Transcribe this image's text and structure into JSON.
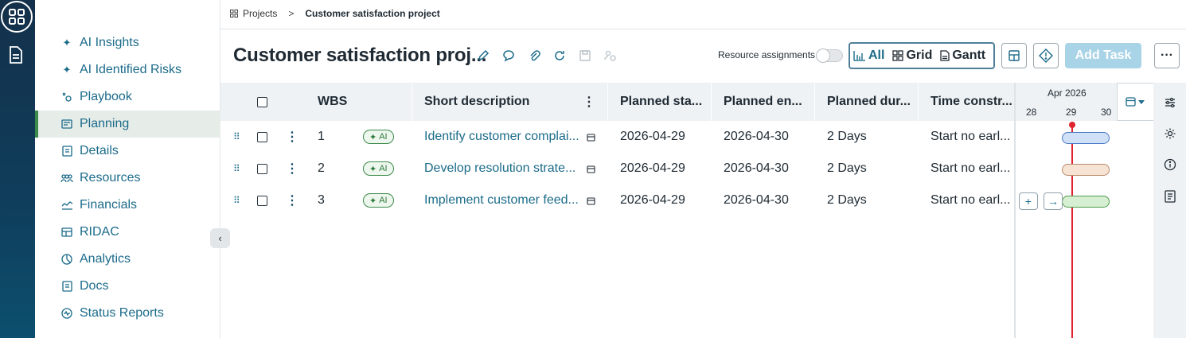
{
  "breadcrumb": {
    "root": "Projects",
    "separator": ">",
    "current": "Customer satisfaction project"
  },
  "sidebar": {
    "items": [
      {
        "label": "AI Insights",
        "icon": "sparkle-icon"
      },
      {
        "label": "AI Identified Risks",
        "icon": "sparkle-icon"
      },
      {
        "label": "Playbook",
        "icon": "playbook-icon"
      },
      {
        "label": "Planning",
        "icon": "planning-icon",
        "active": true
      },
      {
        "label": "Details",
        "icon": "details-icon"
      },
      {
        "label": "Resources",
        "icon": "resources-icon"
      },
      {
        "label": "Financials",
        "icon": "financials-icon"
      },
      {
        "label": "RIDAC",
        "icon": "ridac-icon"
      },
      {
        "label": "Analytics",
        "icon": "analytics-icon"
      },
      {
        "label": "Docs",
        "icon": "docs-icon"
      },
      {
        "label": "Status Reports",
        "icon": "status-reports-icon"
      }
    ]
  },
  "header": {
    "title": "Customer satisfaction proj...",
    "resource_assignments_label": "Resource assignments",
    "resource_assignments_on": false,
    "views": {
      "all": "All",
      "grid": "Grid",
      "gantt": "Gantt"
    },
    "active_view": "all",
    "add_task_label": "Add Task",
    "more_label": "···"
  },
  "table": {
    "columns": {
      "wbs": "WBS",
      "short_description": "Short description",
      "planned_start": "Planned sta...",
      "planned_end": "Planned en...",
      "planned_duration": "Planned dur...",
      "time_constraint": "Time constr..."
    },
    "rows": [
      {
        "wbs": "1",
        "badge": "AI",
        "desc": "Identify customer complai...",
        "start": "2026-04-29",
        "end": "2026-04-30",
        "duration": "2 Days",
        "constraint": "Start no earl..."
      },
      {
        "wbs": "2",
        "badge": "AI",
        "desc": "Develop resolution strate...",
        "start": "2026-04-29",
        "end": "2026-04-30",
        "duration": "2 Days",
        "constraint": "Start no earl..."
      },
      {
        "wbs": "3",
        "badge": "AI",
        "desc": "Implement customer feed...",
        "start": "2026-04-29",
        "end": "2026-04-30",
        "duration": "2 Days",
        "constraint": "Start no earl..."
      }
    ]
  },
  "gantt": {
    "month": "Apr 2026",
    "days": [
      "28",
      "29",
      "30"
    ],
    "bars": [
      {
        "color_fill": "#cfe0f7",
        "color_border": "#4a78c8"
      },
      {
        "color_fill": "#f7e3d4",
        "color_border": "#b88a6a"
      },
      {
        "color_fill": "#d6efd3",
        "color_border": "#4e9b4a"
      }
    ],
    "today_color": "#e0242f",
    "plus_label": "+",
    "arrow_label": "→"
  },
  "colors": {
    "accent": "#1b6b8a",
    "active_nav": "#3c8a4a",
    "add_task": "#a9d3e6"
  }
}
